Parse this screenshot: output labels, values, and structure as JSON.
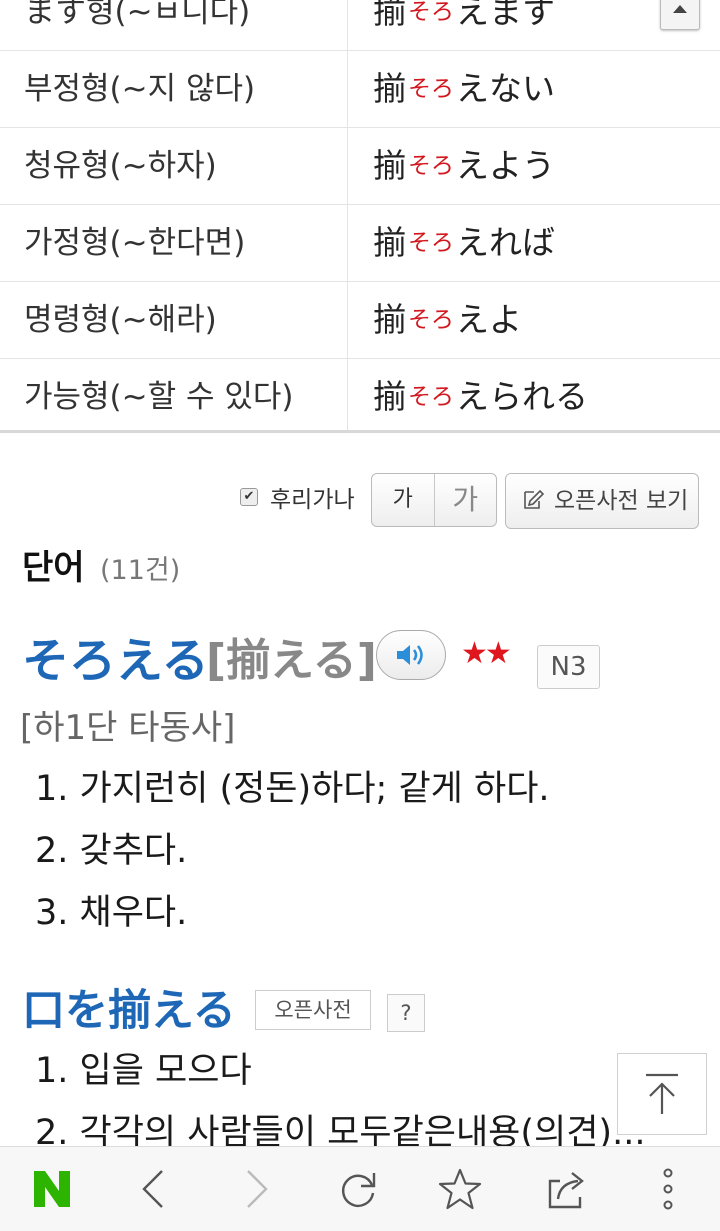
{
  "conjugations": [
    {
      "label": "ます형(~ㅂ니다)",
      "kanji": "揃",
      "furi": "そろ",
      "suffix": "えます"
    },
    {
      "label": "부정형(~지 않다)",
      "kanji": "揃",
      "furi": "そろ",
      "suffix": "えない"
    },
    {
      "label": "청유형(~하자)",
      "kanji": "揃",
      "furi": "そろ",
      "suffix": "えよう"
    },
    {
      "label": "가정형(~한다면)",
      "kanji": "揃",
      "furi": "そろ",
      "suffix": "えれば"
    },
    {
      "label": "명령형(~해라)",
      "kanji": "揃",
      "furi": "そろ",
      "suffix": "えよ"
    },
    {
      "label": "가능형(~할 수 있다)",
      "kanji": "揃",
      "furi": "そろ",
      "suffix": "えられる"
    }
  ],
  "toolbar": {
    "furigana_check": "✔",
    "furigana_label": "후리가나",
    "font_small": "가",
    "font_large": "가",
    "open_dict_label": "오픈사전 보기"
  },
  "words": {
    "heading": "단어",
    "count": "(11건)"
  },
  "entry": {
    "word": "そろえる",
    "kanji": "[揃える]",
    "stars": "★★",
    "jlpt": "N3",
    "pos": "[하1단 타동사]",
    "meanings": [
      "1. 가지런히 (정돈)하다; 같게 하다.",
      "2. 갖추다.",
      "3. 채우다."
    ]
  },
  "idiom": {
    "phrase": "口を揃える",
    "tag": "오픈사전",
    "help": "?",
    "meanings": [
      "1. 입을 모으다",
      "2. 각각의 사람들이 모두같은내용(의견)..."
    ]
  },
  "icons": {
    "scroll_up": "triangle-up-icon",
    "audio": "speaker-icon",
    "back_to_top": "arrow-up-icon",
    "bottom": [
      "naver-n-icon",
      "back-chevron-icon",
      "forward-chevron-icon",
      "refresh-icon",
      "star-icon",
      "share-icon",
      "more-icon"
    ]
  },
  "colors": {
    "accent_blue": "#1d67b6",
    "furigana_red": "#d2181e",
    "naver_green": "#2db400"
  }
}
